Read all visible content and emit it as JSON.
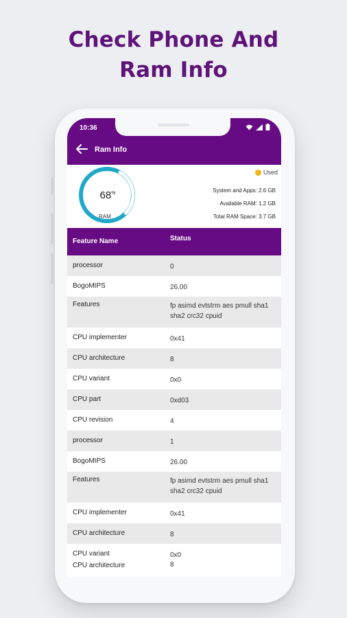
{
  "headline": [
    "Check Phone And",
    "Ram Info"
  ],
  "status_bar": {
    "time": "10:36"
  },
  "app_bar": {
    "title": "Ram Info"
  },
  "ram": {
    "percent": "68",
    "percent_sign": "%",
    "gauge_label": "RAM",
    "used_fraction": 0.68,
    "legend_label": "Used",
    "legend_color": "#f5b51c",
    "system_and_apps": "System and Apps: 2.6 GB",
    "available": "Available RAM: 1.2 GB",
    "total": "Total RAM Space: 3.7 GB"
  },
  "table": {
    "headers": [
      "Feature Name",
      "Status"
    ],
    "rows": [
      {
        "name": "processor",
        "value": "0"
      },
      {
        "name": "BogoMIPS",
        "value": "26.00"
      },
      {
        "name": "Features",
        "value": "fp asimd evtstrm aes pmull sha1 sha2 crc32 cpuid"
      },
      {
        "name": "CPU implementer",
        "value": "0x41"
      },
      {
        "name": "CPU architecture",
        "value": "8"
      },
      {
        "name": "CPU variant",
        "value": "0x0"
      },
      {
        "name": "CPU part",
        "value": "0xd03"
      },
      {
        "name": "CPU revision",
        "value": "4"
      },
      {
        "name": "processor",
        "value": "1"
      },
      {
        "name": "BogoMIPS",
        "value": "26.00"
      },
      {
        "name": "Features",
        "value": "fp asimd evtstrm aes pmull sha1 sha2 crc32 cpuid"
      },
      {
        "name": "CPU implementer",
        "value": "0x41"
      },
      {
        "name": "CPU architecture",
        "value": "8"
      },
      {
        "name": "CPU variant",
        "value": "0x0"
      }
    ],
    "ghost_rows": [
      {
        "name": "CPU architecture",
        "value": "8"
      },
      {
        "name": "CPU variant",
        "value": "0x0"
      }
    ]
  },
  "colors": {
    "brand": "#660b83",
    "gauge_track": "#1fa8c9"
  }
}
